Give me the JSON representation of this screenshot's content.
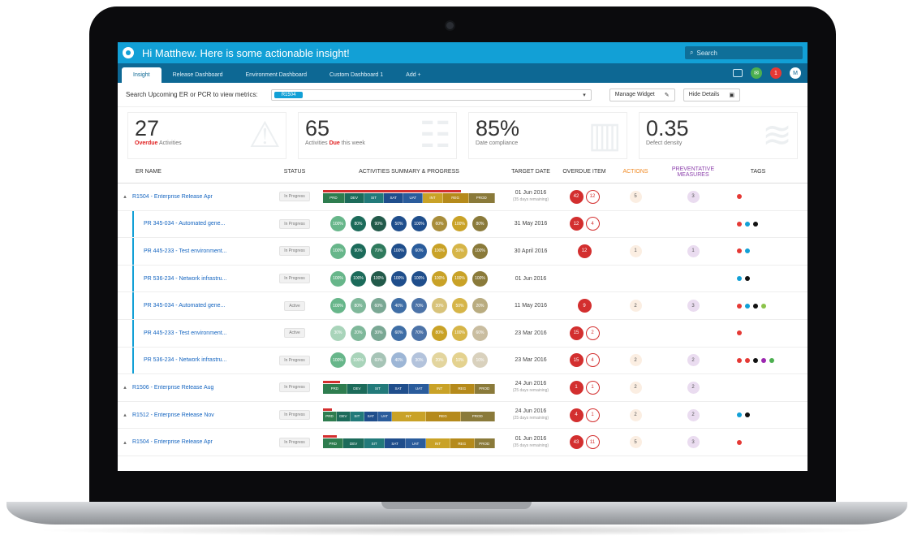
{
  "header": {
    "greeting": "Hi Matthew. Here is some actionable insight!",
    "search_placeholder": "Search",
    "notif_count": "1",
    "avatar_initial": "M"
  },
  "tabs": [
    {
      "label": "Insight",
      "active": true
    },
    {
      "label": "Release Dashboard",
      "active": false
    },
    {
      "label": "Environment Dashboard",
      "active": false
    },
    {
      "label": "Custom Dashboard 1",
      "active": false
    },
    {
      "label": "Add +",
      "active": false
    }
  ],
  "filter": {
    "label": "Search Upcoming ER or PCR to view metrics:",
    "chip": "R1504",
    "manage_widget": "Manage Widget",
    "hide_details": "Hide Details"
  },
  "kpis": [
    {
      "value": "27",
      "label_prefix": "Overdue",
      "label_suffix": " Activities",
      "prefix_red": true
    },
    {
      "value": "65",
      "label_prefix": "Activities ",
      "label_highlight": "Due",
      "label_suffix": " this week"
    },
    {
      "value": "85%",
      "label_prefix": "Date compliance",
      "label_suffix": ""
    },
    {
      "value": "0.35",
      "label_prefix": "Defect density",
      "label_suffix": ""
    }
  ],
  "columns": [
    "ER NAME",
    "STATUS",
    "ACTIVITIES SUMMARY & PROGRESS",
    "TARGET DATE",
    "OVERDUE ITEM",
    "ACTIONS",
    "PREVENTATIVE MEASURES",
    "TAGS"
  ],
  "colors": {
    "accent": "#12a0d6",
    "teal": "#2e8b57",
    "green": "#67b68a",
    "blue": "#1f4e8c",
    "mustard": "#c9a227",
    "olive": "#8a7a3a",
    "red": "#d32f2f"
  },
  "rows": [
    {
      "type": "parent",
      "name": "R1504 - Enterprise Release Apr",
      "status": "In Progress",
      "mode": "bar",
      "top_bar_pct": 0.8,
      "segs": [
        {
          "label": "PRD",
          "w": 10,
          "c": "#2e7d4f"
        },
        {
          "label": "DEV",
          "w": 9,
          "c": "#1c6b5a"
        },
        {
          "label": "SIT",
          "w": 9,
          "c": "#227a7a"
        },
        {
          "label": "SAT",
          "w": 9,
          "c": "#1f4e8c"
        },
        {
          "label": "UAT",
          "w": 9,
          "c": "#2a5c9c"
        },
        {
          "label": "INT",
          "w": 9,
          "c": "#c9a227"
        },
        {
          "label": "REG",
          "w": 12,
          "c": "#b58a1b"
        },
        {
          "label": "PROD",
          "w": 12,
          "c": "#8a7a3a"
        }
      ],
      "date": "01 Jun 2016",
      "date_sub": "(35 days remaining)",
      "ov_filled": "42",
      "ov_outline": "12",
      "actions": "5",
      "prev": "3",
      "tags": [
        "#e53935"
      ]
    },
    {
      "type": "child",
      "name": "PR 345-034 - Automated gene...",
      "status": "In Progress",
      "mode": "dots",
      "dots": [
        {
          "t": "100%",
          "c": "#67b68a"
        },
        {
          "t": "80%",
          "c": "#1c6b5a"
        },
        {
          "t": "90%",
          "c": "#225a4a"
        },
        {
          "t": "50%",
          "c": "#1f4e8c"
        },
        {
          "t": "100%",
          "c": "#1f4e8c"
        },
        {
          "t": "60%",
          "c": "#a88d3a"
        },
        {
          "t": "100%",
          "c": "#c9a227"
        },
        {
          "t": "80%",
          "c": "#8a7a3a"
        }
      ],
      "date": "31 May 2016",
      "date_sub": "",
      "ov_filled": "12",
      "ov_outline": "4",
      "actions": "",
      "prev": "",
      "tags": [
        "#e53935",
        "#12a0d6",
        "#111111"
      ]
    },
    {
      "type": "child",
      "name": "PR 445-233 - Test environment...",
      "status": "In Progress",
      "mode": "dots",
      "dots": [
        {
          "t": "100%",
          "c": "#67b68a"
        },
        {
          "t": "90%",
          "c": "#1c6b5a"
        },
        {
          "t": "70%",
          "c": "#2f7a5d"
        },
        {
          "t": "100%",
          "c": "#1f4e8c"
        },
        {
          "t": "60%",
          "c": "#2a5c9c"
        },
        {
          "t": "100%",
          "c": "#c9a227"
        },
        {
          "t": "50%",
          "c": "#d6b548"
        },
        {
          "t": "100%",
          "c": "#8a7a3a"
        }
      ],
      "date": "30 April 2016",
      "date_sub": "",
      "ov_filled": "12",
      "ov_outline": "",
      "actions": "1",
      "prev": "1",
      "tags": [
        "#e53935",
        "#12a0d6"
      ]
    },
    {
      "type": "child",
      "name": "PR 536-234 - Network infrastru...",
      "status": "In Progress",
      "mode": "dots",
      "dots": [
        {
          "t": "100%",
          "c": "#67b68a"
        },
        {
          "t": "100%",
          "c": "#1c6b5a"
        },
        {
          "t": "100%",
          "c": "#225a4a"
        },
        {
          "t": "100%",
          "c": "#1f4e8c"
        },
        {
          "t": "100%",
          "c": "#1f4e8c"
        },
        {
          "t": "100%",
          "c": "#c9a227"
        },
        {
          "t": "100%",
          "c": "#c9a227"
        },
        {
          "t": "100%",
          "c": "#8a7a3a"
        }
      ],
      "date": "01 Jun 2016",
      "date_sub": "",
      "ov_filled": "",
      "ov_outline": "",
      "actions": "",
      "prev": "",
      "tags": [
        "#12a0d6",
        "#111111"
      ]
    },
    {
      "type": "child",
      "name": "PR 345-034 - Automated gene...",
      "status": "Active",
      "mode": "dots",
      "dots": [
        {
          "t": "100%",
          "c": "#67b68a"
        },
        {
          "t": "80%",
          "c": "#7fb89a"
        },
        {
          "t": "60%",
          "c": "#7aa894"
        },
        {
          "t": "40%",
          "c": "#3f6ea6"
        },
        {
          "t": "70%",
          "c": "#4c73a8"
        },
        {
          "t": "30%",
          "c": "#d8c37a"
        },
        {
          "t": "50%",
          "c": "#d6b548"
        },
        {
          "t": "20%",
          "c": "#b9ac80"
        }
      ],
      "date": "11 May 2016",
      "date_sub": "",
      "ov_filled": "9",
      "ov_outline": "",
      "actions": "2",
      "prev": "3",
      "tags": [
        "#e53935",
        "#12a0d6",
        "#111111",
        "#8bc34a"
      ]
    },
    {
      "type": "child",
      "name": "PR 445-233 - Test environment...",
      "status": "Active",
      "mode": "dots",
      "dots": [
        {
          "t": "30%",
          "c": "#a9d4ba"
        },
        {
          "t": "20%",
          "c": "#7fb89a"
        },
        {
          "t": "30%",
          "c": "#7aa894"
        },
        {
          "t": "60%",
          "c": "#3f6ea6"
        },
        {
          "t": "70%",
          "c": "#4c73a8"
        },
        {
          "t": "80%",
          "c": "#c9a227"
        },
        {
          "t": "100%",
          "c": "#d6b548"
        },
        {
          "t": "60%",
          "c": "#c9bda0"
        }
      ],
      "date": "23 Mar 2016",
      "date_sub": "",
      "ov_filled": "15",
      "ov_outline": "2",
      "actions": "",
      "prev": "",
      "tags": [
        "#e53935"
      ]
    },
    {
      "type": "child",
      "name": "PR 536-234 - Network infrastru...",
      "status": "In Progress",
      "mode": "dots",
      "dots": [
        {
          "t": "100%",
          "c": "#67b68a"
        },
        {
          "t": "100%",
          "c": "#a9d4ba"
        },
        {
          "t": "60%",
          "c": "#a6c4b6"
        },
        {
          "t": "40%",
          "c": "#9db6d6"
        },
        {
          "t": "30%",
          "c": "#b3c3dc"
        },
        {
          "t": "20%",
          "c": "#e3d59e"
        },
        {
          "t": "10%",
          "c": "#e4d28f"
        },
        {
          "t": "10%",
          "c": "#d9d1bd"
        }
      ],
      "date": "23 Mar 2016",
      "date_sub": "",
      "ov_filled": "15",
      "ov_outline": "4",
      "actions": "2",
      "prev": "2",
      "tags": [
        "#e53935",
        "#e53935",
        "#111111",
        "#9c27b0",
        "#4caf50"
      ]
    },
    {
      "type": "parent",
      "name": "R1506 - Enterprise Release Aug",
      "status": "In Progress",
      "mode": "bar",
      "top_bar_pct": 0.1,
      "segs": [
        {
          "label": "PRD",
          "w": 14,
          "c": "#2e7d4f"
        },
        {
          "label": "DEV",
          "w": 12,
          "c": "#1c6b5a"
        },
        {
          "label": "SIT",
          "w": 12,
          "c": "#227a7a"
        },
        {
          "label": "SAT",
          "w": 12,
          "c": "#1f4e8c"
        },
        {
          "label": "UAT",
          "w": 12,
          "c": "#2a5c9c"
        },
        {
          "label": "INT",
          "w": 12,
          "c": "#c9a227"
        },
        {
          "label": "REG",
          "w": 14,
          "c": "#b58a1b"
        },
        {
          "label": "PROD",
          "w": 12,
          "c": "#8a7a3a"
        }
      ],
      "date": "24 Jun 2016",
      "date_sub": "(25 days remaining)",
      "ov_filled": "1",
      "ov_outline": "1",
      "actions": "2",
      "prev": "2",
      "tags": []
    },
    {
      "type": "parent",
      "name": "R1512 - Enterprise Release Nov",
      "status": "In Progress",
      "mode": "bar",
      "top_bar_pct": 0.05,
      "segs": [
        {
          "label": "PRD",
          "w": 8,
          "c": "#2e7d4f"
        },
        {
          "label": "DEV",
          "w": 8,
          "c": "#1c6b5a"
        },
        {
          "label": "SIT",
          "w": 8,
          "c": "#227a7a"
        },
        {
          "label": "SAT",
          "w": 8,
          "c": "#1f4e8c"
        },
        {
          "label": "UAT",
          "w": 8,
          "c": "#2a5c9c"
        },
        {
          "label": "INT",
          "w": 20,
          "c": "#c9a227"
        },
        {
          "label": "REG",
          "w": 20,
          "c": "#b58a1b"
        },
        {
          "label": "PROD",
          "w": 20,
          "c": "#8a7a3a"
        }
      ],
      "date": "24 Jun 2016",
      "date_sub": "(25 days remaining)",
      "ov_filled": "4",
      "ov_outline": "1",
      "actions": "2",
      "prev": "2",
      "tags": [
        "#12a0d6",
        "#111111"
      ]
    },
    {
      "type": "parent",
      "name": "R1504 - Enterprise Release Apr",
      "status": "In Progress",
      "mode": "bar",
      "top_bar_pct": 0.08,
      "segs": [
        {
          "label": "PRD",
          "w": 12,
          "c": "#2e7d4f"
        },
        {
          "label": "DEV",
          "w": 12,
          "c": "#1c6b5a"
        },
        {
          "label": "SIT",
          "w": 12,
          "c": "#227a7a"
        },
        {
          "label": "SAT",
          "w": 12,
          "c": "#1f4e8c"
        },
        {
          "label": "UAT",
          "w": 12,
          "c": "#2a5c9c"
        },
        {
          "label": "INT",
          "w": 14,
          "c": "#c9a227"
        },
        {
          "label": "REG",
          "w": 14,
          "c": "#b58a1b"
        },
        {
          "label": "PROD",
          "w": 12,
          "c": "#8a7a3a"
        }
      ],
      "date": "01 Jun 2016",
      "date_sub": "(35 days remaining)",
      "ov_filled": "43",
      "ov_outline": "11",
      "actions": "5",
      "prev": "3",
      "tags": [
        "#e53935"
      ]
    }
  ]
}
